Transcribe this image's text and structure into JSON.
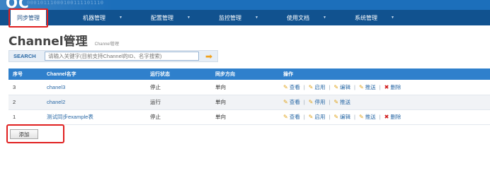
{
  "banner": {
    "logo_text": "OC",
    "binary_text": "00010111000100111101110"
  },
  "nav": {
    "items": [
      {
        "label": "同步管理"
      },
      {
        "label": "机器管理"
      },
      {
        "label": "配置管理"
      },
      {
        "label": "监控管理"
      },
      {
        "label": "使用文档"
      },
      {
        "label": "系统管理"
      }
    ],
    "arrow_glyph": "▼"
  },
  "page": {
    "title": "Channel管理",
    "subtitle": "Channel管理"
  },
  "search": {
    "label": "SEARCH",
    "placeholder": "请输入关键字(目前支持Channel的ID、名字搜索)",
    "value": "",
    "go_icon": "arrow-right-icon"
  },
  "table": {
    "headers": [
      "序号",
      "Channel名字",
      "运行状态",
      "同步方向",
      "操作"
    ],
    "rows": [
      {
        "no": "3",
        "name": "chanel3",
        "status": "停止",
        "direction": "单向",
        "ops": [
          "查看",
          "启用",
          "编辑",
          "推送",
          "删除"
        ]
      },
      {
        "no": "2",
        "name": "chanel2",
        "status": "运行",
        "direction": "单向",
        "ops": [
          "查看",
          "停用",
          "推送"
        ]
      },
      {
        "no": "1",
        "name": "测试同步example表",
        "status": "停止",
        "direction": "单向",
        "ops": [
          "查看",
          "启用",
          "编辑",
          "推送",
          "删除"
        ]
      }
    ],
    "colors": {
      "header_bg": "#2f80cc",
      "running": "#3e9a2c",
      "link": "#2a69a6",
      "delete_x": "#d01b1b"
    }
  },
  "actions": {
    "add_label": "添加"
  },
  "highlights": {
    "color": "#e02020",
    "targets": [
      "nav-item-sync-management",
      "add-button"
    ]
  }
}
